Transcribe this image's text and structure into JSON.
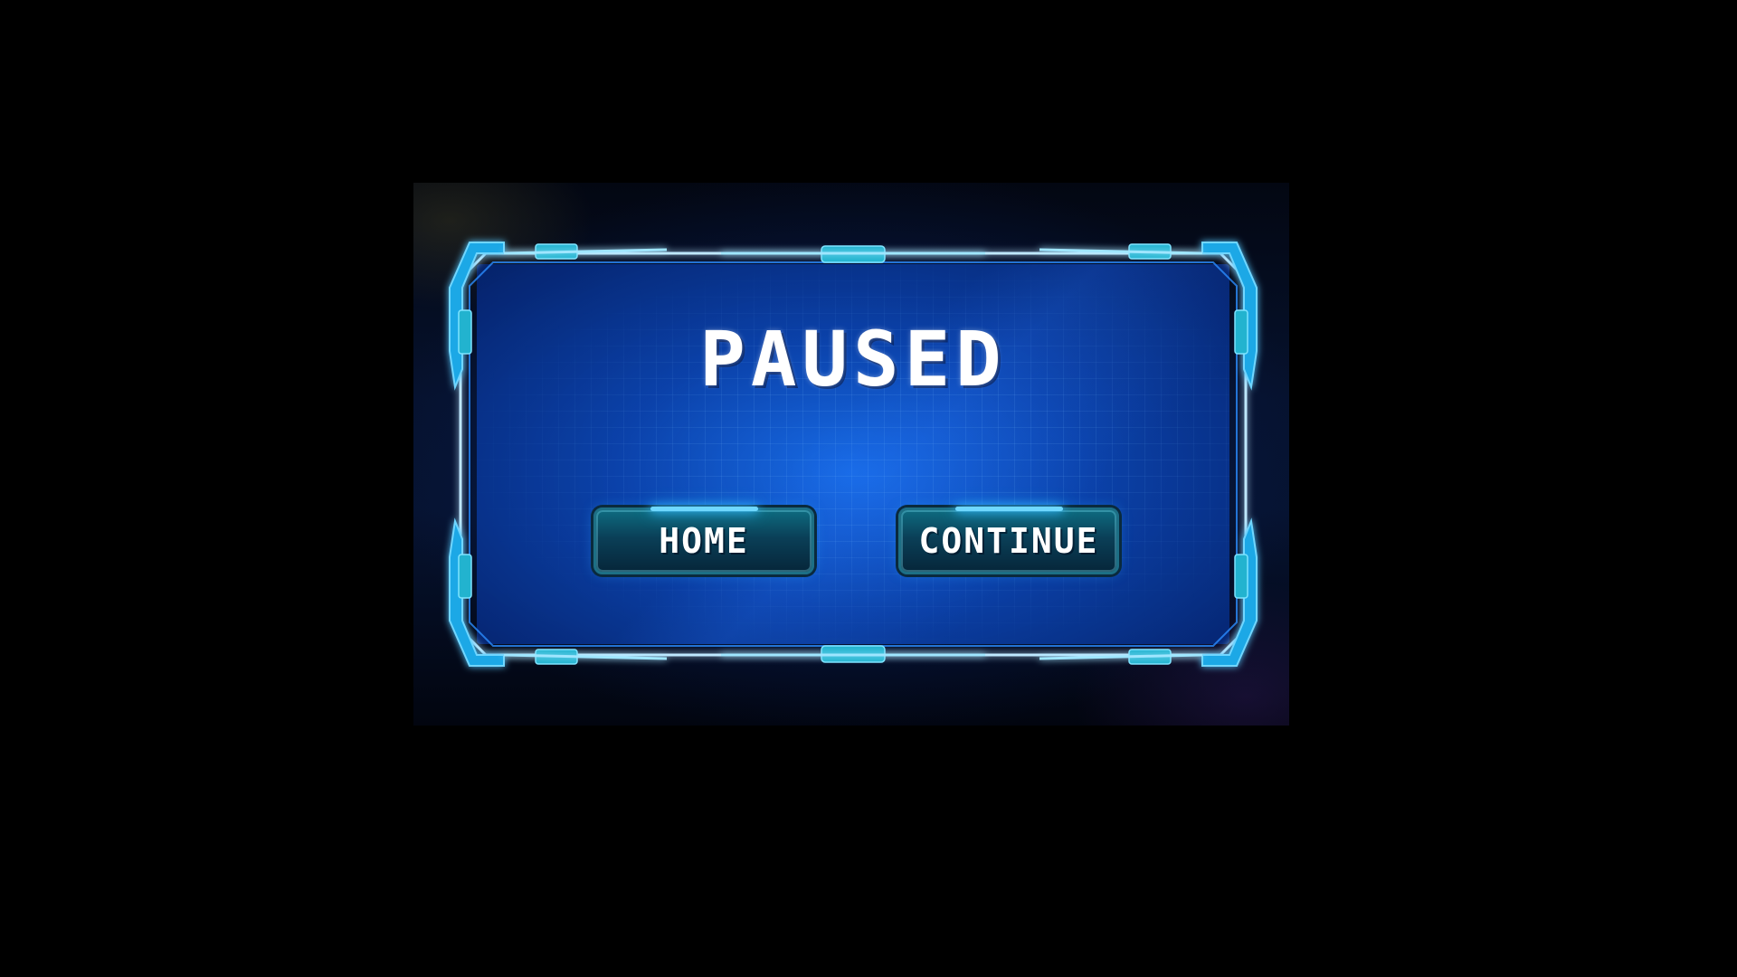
{
  "pause_menu": {
    "title": "PAUSED",
    "buttons": {
      "home_label": "HOME",
      "continue_label": "CONTINUE"
    }
  },
  "colors": {
    "background": "#000000",
    "frame_cyan": "#35b8ff",
    "screen_blue": "#1a6fe0",
    "button_teal": "#0e6b80",
    "text": "#ffffff"
  },
  "icons": {
    "frame": "sci-fi-hud-frame"
  }
}
